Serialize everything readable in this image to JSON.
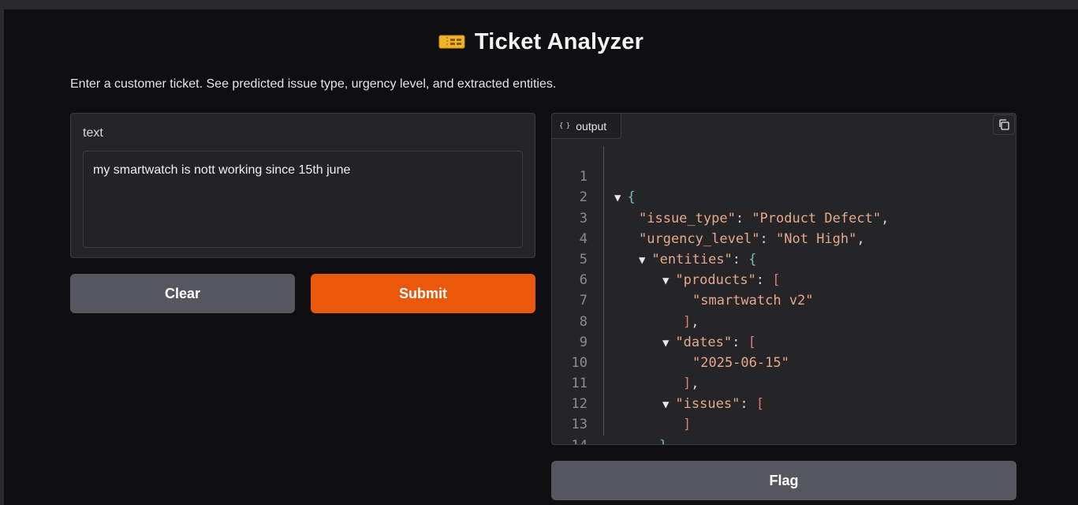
{
  "app": {
    "title": "Ticket Analyzer",
    "title_icon": "ticket-icon",
    "description": "Enter a customer ticket. See predicted issue type, urgency level, and extracted entities."
  },
  "input": {
    "label": "text",
    "value": "my smartwatch is nott working since 15th june"
  },
  "buttons": {
    "clear": "Clear",
    "submit": "Submit",
    "flag": "Flag"
  },
  "output": {
    "tab_label": "output",
    "tab_icon": "braces-icon",
    "copy_icon": "copy-icon",
    "json": {
      "issue_type_key": "\"issue_type\"",
      "issue_type_value": "\"Product Defect\"",
      "urgency_key": "\"urgency_level\"",
      "urgency_value": "\"Not High\"",
      "entities_key": "\"entities\"",
      "products_key": "\"products\"",
      "product_1": "\"smartwatch v2\"",
      "dates_key": "\"dates\"",
      "date_1": "\"2025-06-15\"",
      "issues_key": "\"issues\""
    },
    "line_numbers": [
      "1",
      "2",
      "3",
      "4",
      "5",
      "6",
      "7",
      "8",
      "9",
      "10",
      "11",
      "12",
      "13",
      "14"
    ]
  },
  "colors": {
    "accent": "#ea580c",
    "button_secondary": "#56565e",
    "background": "#0f0f11",
    "panel": "#252528"
  }
}
